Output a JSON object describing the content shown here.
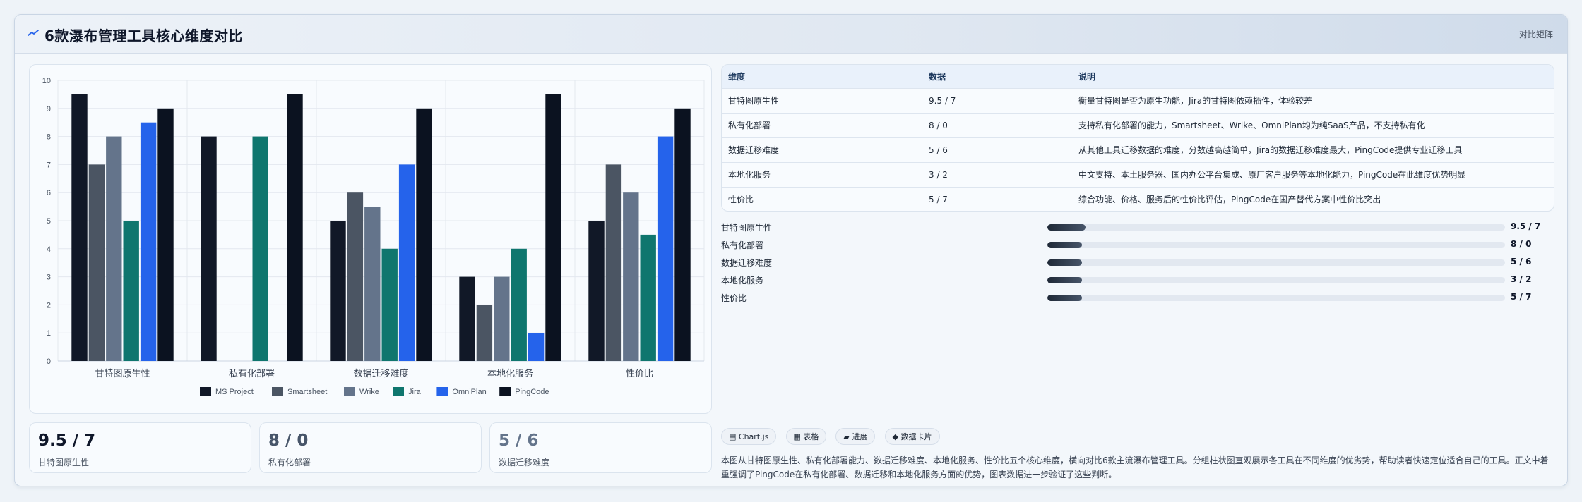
{
  "header": {
    "title": "6款瀑布管理工具核心维度对比",
    "badge": "对比矩阵"
  },
  "chart_data": {
    "type": "bar",
    "categories": [
      "甘特图原生性",
      "私有化部署",
      "数据迁移难度",
      "本地化服务",
      "性价比"
    ],
    "series": [
      {
        "name": "MS Project",
        "color": "#111827",
        "values": [
          9.5,
          8,
          5,
          3,
          5
        ]
      },
      {
        "name": "Smartsheet",
        "color": "#4b5563",
        "values": [
          7,
          0,
          6,
          2,
          7
        ]
      },
      {
        "name": "Wrike",
        "color": "#64748b",
        "values": [
          8,
          0,
          5.5,
          3,
          6
        ]
      },
      {
        "name": "Jira",
        "color": "#0f766e",
        "values": [
          5,
          8,
          4,
          4,
          4.5
        ]
      },
      {
        "name": "OmniPlan",
        "color": "#2563eb",
        "values": [
          8.5,
          0,
          7,
          1,
          8
        ]
      },
      {
        "name": "PingCode",
        "color": "#0b1220",
        "values": [
          9,
          9.5,
          9,
          9.5,
          9
        ]
      }
    ],
    "ylim": [
      0,
      10
    ],
    "yticks": [
      "0",
      "1",
      "2",
      "3",
      "4",
      "5",
      "6",
      "7",
      "8",
      "9",
      "10"
    ],
    "grid": true,
    "legend_position": "bottom"
  },
  "stats": [
    {
      "value": "9.5 / 7",
      "label": "甘特图原生性",
      "color": "#0f172a"
    },
    {
      "value": "8 / 0",
      "label": "私有化部署",
      "color": "#475569"
    },
    {
      "value": "5 / 6",
      "label": "数据迁移难度",
      "color": "#64748b"
    }
  ],
  "table": {
    "headers": [
      "维度",
      "数据",
      "说明"
    ],
    "rows": [
      [
        "甘特图原生性",
        "9.5 / 7",
        "衡量甘特图是否为原生功能，Jira的甘特图依赖插件，体验较差"
      ],
      [
        "私有化部署",
        "8 / 0",
        "支持私有化部署的能力，Smartsheet、Wrike、OmniPlan均为纯SaaS产品，不支持私有化"
      ],
      [
        "数据迁移难度",
        "5 / 6",
        "从其他工具迁移数据的难度，分数越高越简单，Jira的数据迁移难度最大，PingCode提供专业迁移工具"
      ],
      [
        "本地化服务",
        "3 / 2",
        "中文支持、本土服务器、国内办公平台集成、原厂客户服务等本地化能力，PingCode在此维度优势明显"
      ],
      [
        "性价比",
        "5 / 7",
        "综合功能、价格、服务后的性价比评估，PingCode在国产替代方案中性价比突出"
      ]
    ]
  },
  "progress": [
    {
      "label": "甘特图原生性",
      "value": "9.5 / 7",
      "fraction": 0.083
    },
    {
      "label": "私有化部署",
      "value": "8 / 0",
      "fraction": 0.075
    },
    {
      "label": "数据迁移难度",
      "value": "5 / 6",
      "fraction": 0.075
    },
    {
      "label": "本地化服务",
      "value": "3 / 2",
      "fraction": 0.075
    },
    {
      "label": "性价比",
      "value": "5 / 7",
      "fraction": 0.075
    }
  ],
  "chips": [
    "▤ Chart.js",
    "▦ 表格",
    "▰ 进度",
    "◆ 数据卡片"
  ],
  "description": "本图从甘特图原生性、私有化部署能力、数据迁移难度、本地化服务、性价比五个核心维度，横向对比6款主流瀑布管理工具。分组柱状图直观展示各工具在不同维度的优劣势，帮助读者快速定位适合自己的工具。正文中着重强调了PingCode在私有化部署、数据迁移和本地化服务方面的优势，图表数据进一步验证了这些判断。"
}
